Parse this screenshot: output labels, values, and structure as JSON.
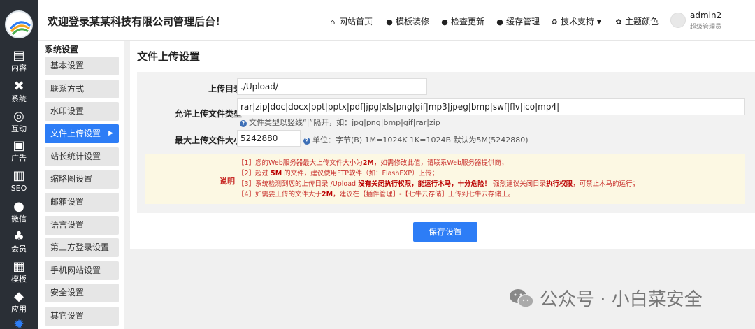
{
  "sidebar_icons": [
    {
      "icon": "content-icon",
      "label": "内容"
    },
    {
      "icon": "tools-icon",
      "label": "系统"
    },
    {
      "icon": "interaction-icon",
      "label": "互动"
    },
    {
      "icon": "ad-icon",
      "label": "广告"
    },
    {
      "icon": "seo-icon",
      "label": "SEO"
    },
    {
      "icon": "wechat-icon",
      "label": "微信"
    },
    {
      "icon": "member-icon",
      "label": "会员"
    },
    {
      "icon": "template-icon",
      "label": "模板"
    },
    {
      "icon": "app-icon",
      "label": "应用"
    }
  ],
  "header": {
    "title": "欢迎登录某某科技有限公司管理后台!",
    "nav": [
      {
        "icon": "home-icon",
        "label": "网站首页"
      },
      {
        "icon": "shirt-icon",
        "label": "模板装修"
      },
      {
        "icon": "update-icon",
        "label": "检查更新"
      },
      {
        "icon": "cache-icon",
        "label": "缓存管理"
      },
      {
        "icon": "support-icon",
        "label": "技术支持 ▾"
      },
      {
        "icon": "palette-icon",
        "label": "主题颜色"
      }
    ],
    "user": {
      "name": "admin2",
      "role": "超级管理员"
    }
  },
  "menu": {
    "heading": "系统设置",
    "items": [
      "基本设置",
      "联系方式",
      "水印设置",
      "文件上传设置",
      "站长统计设置",
      "缩略图设置",
      "邮箱设置",
      "语言设置",
      "第三方登录设置",
      "手机网站设置",
      "安全设置",
      "其它设置"
    ],
    "active_index": 3
  },
  "page": {
    "title": "文件上传设置",
    "upload_dir": {
      "label": "上传目录",
      "value": "./Upload/"
    },
    "file_types": {
      "label": "允许上传文件类型",
      "value": "rar|zip|doc|docx|ppt|pptx|pdf|jpg|xls|png|gif|mp3|jpeg|bmp|swf|flv|ico|mp4|",
      "hint": "文件类型以竖线“|”隔开，如：jpg|png|bmp|gif|rar|zip"
    },
    "max_size": {
      "label": "最大上传文件大小",
      "value": "5242880",
      "hint": "单位：字节(B)  1M=1024K  1K=1024B  默认为5M(5242880)"
    },
    "notice": {
      "label": "说明",
      "line1_a": "【1】您的Web服务器最大上传文件大小为",
      "line1_b": "2M",
      "line1_c": "，如需修改此值，请联系Web服务器提供商；",
      "line2_a": "【2】超过 ",
      "line2_b": "5M",
      "line2_c": " 的文件，建议使用FTP软件（如：FlashFXP）上传；",
      "line3_a": "【3】系统检测到您的上传目录 /Upload ",
      "line3_b": "没有关闭执行权限，能运行木马，十分危险！",
      "line3_c": " 强烈建议关闭目录",
      "line3_d": "执行权限",
      "line3_e": "，可禁止木马的运行；",
      "line4_a": "【4】如需要上传的文件大于",
      "line4_b": "2M",
      "line4_c": "，建议在【插件管理】-【七牛云存储】上传到七牛云存储上。"
    },
    "save_label": "保存设置"
  },
  "watermark": {
    "text": "公众号 · 小白菜安全",
    "icon": "wechat-icon"
  },
  "colors": {
    "sidebar_bg": "#2a2f36",
    "accent": "#2d7df6",
    "danger": "#c9302c",
    "notice_bg": "#fcf8e3"
  }
}
